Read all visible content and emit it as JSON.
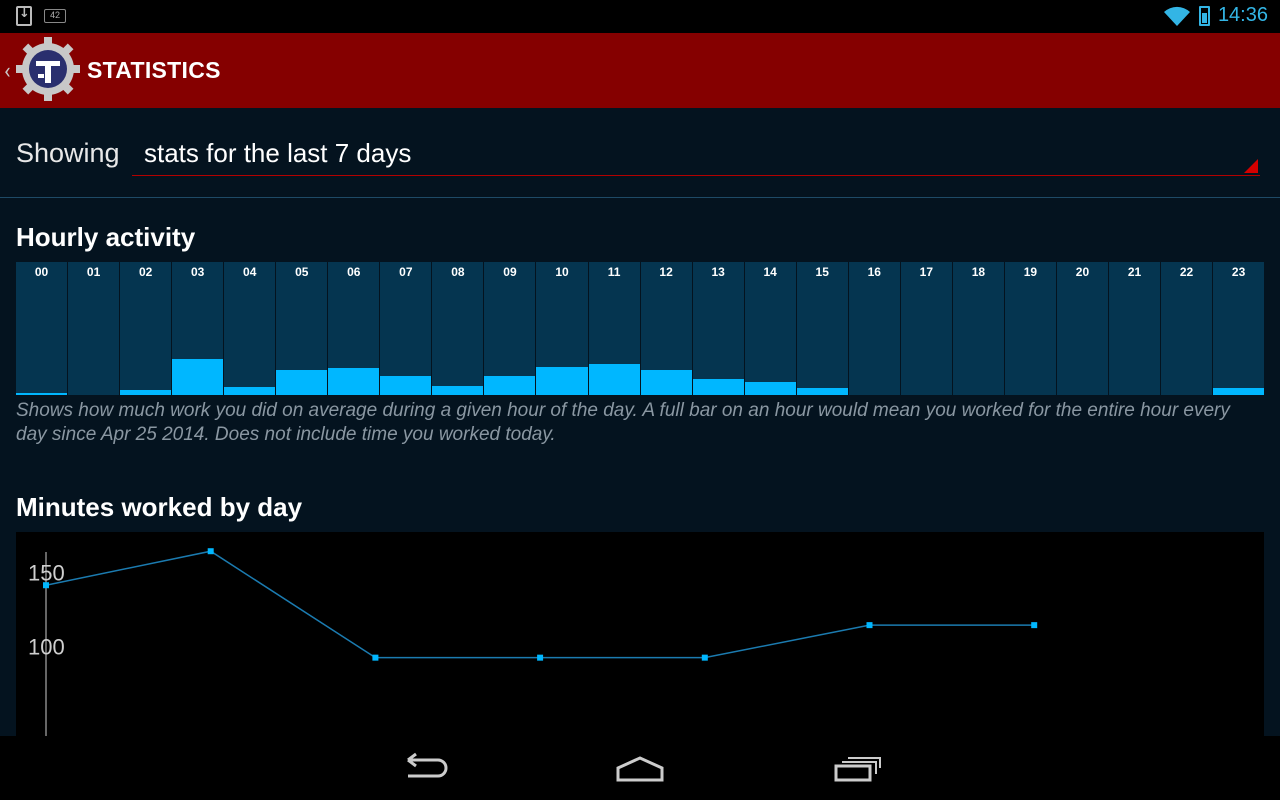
{
  "status_bar": {
    "left_icons": [
      "download-icon",
      "notification-badge-icon"
    ],
    "badge_text": "42",
    "right_icons": [
      "wifi-icon",
      "battery-icon"
    ],
    "time": "14:36",
    "accent_color": "#33b5e5"
  },
  "action_bar": {
    "title": "STATISTICS",
    "background": "#850000",
    "icons": [
      "up-caret-icon",
      "app-gear-logo-icon"
    ]
  },
  "filter": {
    "label": "Showing",
    "selected": "stats for the last 7 days"
  },
  "hourly": {
    "title": "Hourly activity",
    "note": "Shows how much work you did on average during a given hour of the day. A full bar on an hour would mean you worked for the entire hour every day since Apr 25 2014. Does not include time you worked today.",
    "hours": [
      "00",
      "01",
      "02",
      "03",
      "04",
      "05",
      "06",
      "07",
      "08",
      "09",
      "10",
      "11",
      "12",
      "13",
      "14",
      "15",
      "16",
      "17",
      "18",
      "19",
      "20",
      "21",
      "22",
      "23"
    ],
    "fractions": [
      0.015,
      0,
      0.04,
      0.27,
      0.06,
      0.19,
      0.2,
      0.14,
      0.07,
      0.14,
      0.21,
      0.23,
      0.19,
      0.12,
      0.1,
      0.05,
      0,
      0,
      0,
      0,
      0,
      0,
      0,
      0.05
    ],
    "fill_color": "#00b7ff",
    "track_color": "#053550"
  },
  "daily": {
    "title": "Minutes worked by day"
  },
  "chart_data": {
    "type": "line",
    "title": "Minutes worked by day",
    "x": [
      1,
      2,
      3,
      4,
      5,
      6,
      7
    ],
    "series": [
      {
        "values": [
          142,
          165,
          93,
          93,
          93,
          115,
          115
        ]
      }
    ],
    "yticks": [
      100,
      150
    ],
    "ylim": [
      40,
      178
    ],
    "xlabel": "",
    "ylabel": "",
    "grid": false,
    "line_color": "#1b7bb0",
    "marker_color": "#00b7ff"
  },
  "navbar": {
    "icons": [
      "back-icon",
      "home-icon",
      "recent-apps-icon"
    ]
  }
}
